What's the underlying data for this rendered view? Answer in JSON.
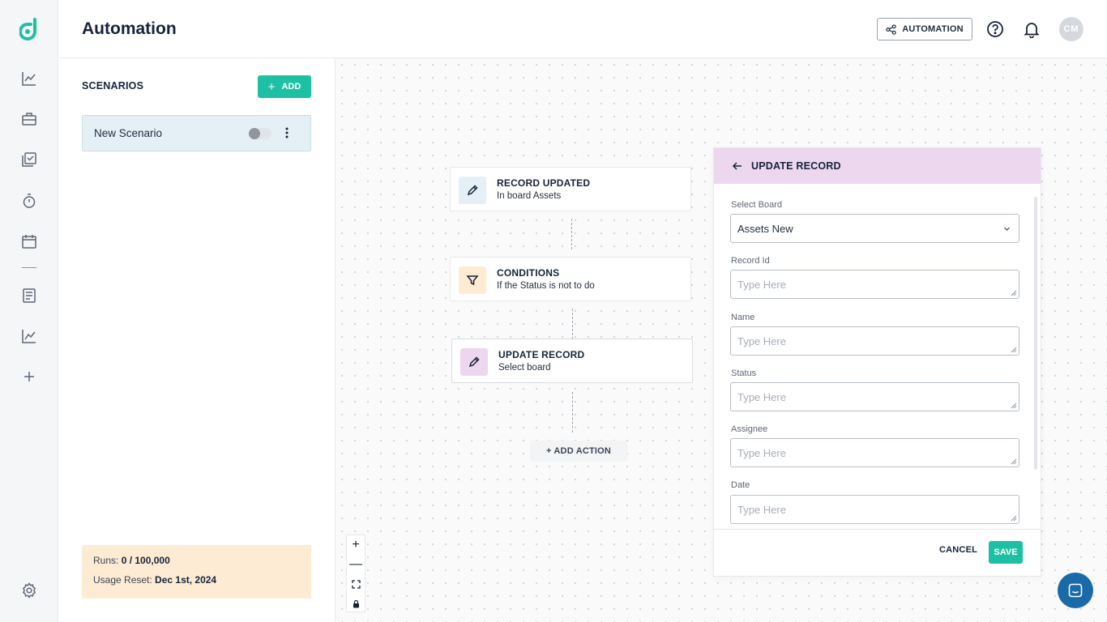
{
  "header": {
    "title": "Automation",
    "automation_button": "AUTOMATION",
    "avatar_initials": "CM"
  },
  "rail": {
    "items": [
      "logo-icon",
      "analytics-icon",
      "briefcase-icon",
      "tasks-icon",
      "timer-icon",
      "calendar-icon",
      "document-icon",
      "chart-icon",
      "add-icon",
      "settings-icon"
    ]
  },
  "scenarios": {
    "title": "SCENARIOS",
    "add_label": "ADD",
    "items": [
      {
        "name": "New Scenario",
        "enabled": false
      }
    ],
    "usage": {
      "runs_label": "Runs:",
      "runs_value": "0 / 100,000",
      "reset_label": "Usage Reset:",
      "reset_value": "Dec 1st, 2024"
    }
  },
  "flow": {
    "nodes": [
      {
        "title": "RECORD UPDATED",
        "subtitle": "In board Assets"
      },
      {
        "title": "CONDITIONS",
        "subtitle": "If the Status is not to do"
      },
      {
        "title": "UPDATE RECORD",
        "subtitle": "Select board"
      }
    ],
    "add_action": "+ ADD ACTION"
  },
  "zoom_controls": [
    "+",
    "—"
  ],
  "panel": {
    "title": "UPDATE RECORD",
    "select_board_label": "Select Board",
    "select_board_value": "Assets New",
    "fields": [
      {
        "label": "Record Id",
        "placeholder": "Type Here"
      },
      {
        "label": "Name",
        "placeholder": "Type Here"
      },
      {
        "label": "Status",
        "placeholder": "Type Here"
      },
      {
        "label": "Assignee",
        "placeholder": "Type Here"
      },
      {
        "label": "Date",
        "placeholder": "Type Here"
      }
    ],
    "cancel": "CANCEL",
    "save": "SAVE"
  },
  "colors": {
    "accent": "#1ec0a4",
    "panel_header": "#ecd7ee",
    "usage_bg": "#fdebd3",
    "selected_scenario": "#e4f0f6"
  }
}
